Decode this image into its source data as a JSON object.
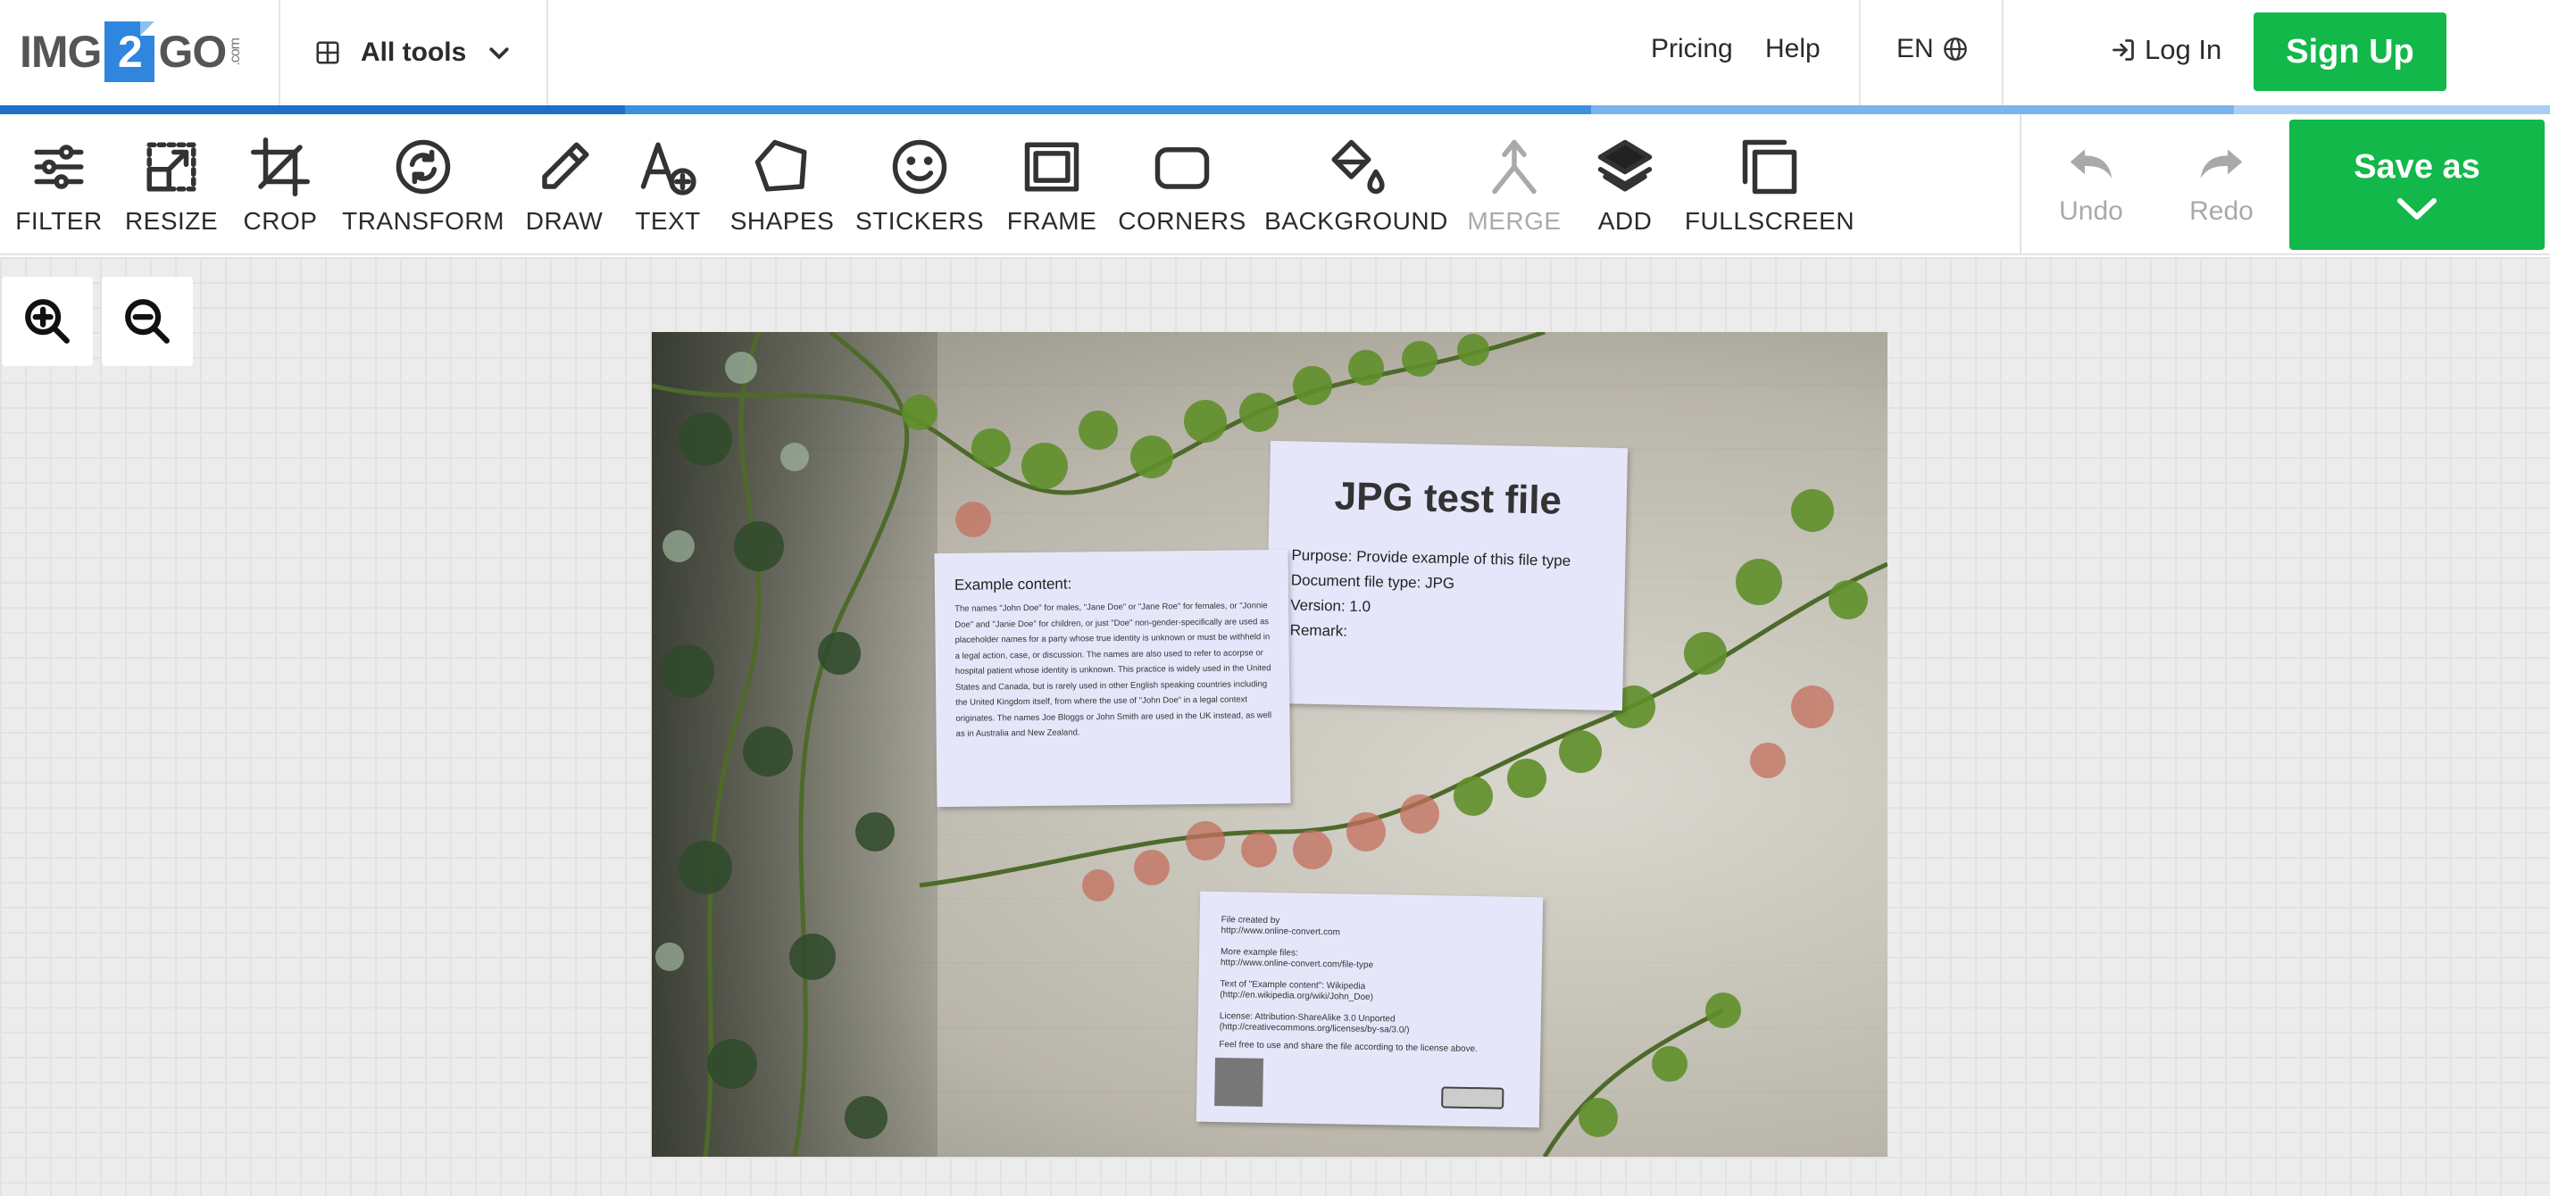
{
  "header": {
    "logo": {
      "img": "IMG",
      "two": "2",
      "go": "GO",
      "com": ".com"
    },
    "all_tools": "All tools",
    "pricing": "Pricing",
    "help": "Help",
    "language": "EN",
    "login": "Log In",
    "signup": "Sign Up"
  },
  "progress_colors": [
    "#1f6fc8",
    "#3d8fe0",
    "#7bb4ef",
    "#a9cff5"
  ],
  "toolbar": {
    "tools": [
      {
        "label": "FILTER",
        "icon": "sliders-icon",
        "enabled": true
      },
      {
        "label": "RESIZE",
        "icon": "resize-icon",
        "enabled": true
      },
      {
        "label": "CROP",
        "icon": "crop-icon",
        "enabled": true
      },
      {
        "label": "TRANSFORM",
        "icon": "rotate-icon",
        "enabled": true
      },
      {
        "label": "DRAW",
        "icon": "pencil-icon",
        "enabled": true
      },
      {
        "label": "TEXT",
        "icon": "text-add-icon",
        "enabled": true
      },
      {
        "label": "SHAPES",
        "icon": "pentagon-icon",
        "enabled": true
      },
      {
        "label": "STICKERS",
        "icon": "smiley-icon",
        "enabled": true
      },
      {
        "label": "FRAME",
        "icon": "frame-icon",
        "enabled": true
      },
      {
        "label": "CORNERS",
        "icon": "rounded-rect-icon",
        "enabled": true
      },
      {
        "label": "BACKGROUND",
        "icon": "paint-bucket-icon",
        "enabled": true
      },
      {
        "label": "MERGE",
        "icon": "merge-icon",
        "enabled": false
      },
      {
        "label": "ADD",
        "icon": "layers-icon",
        "enabled": true
      },
      {
        "label": "FULLSCREEN",
        "icon": "fullscreen-icon",
        "enabled": true
      }
    ],
    "undo": "Undo",
    "redo": "Redo",
    "save_as": "Save as"
  },
  "canvas": {
    "zoom_in": "zoom-in-icon",
    "zoom_out": "zoom-out-icon",
    "photo": {
      "paper_main": {
        "title": "JPG test file",
        "lines": [
          "Purpose: Provide example of this file type",
          "Document file type: JPG",
          "Version: 1.0",
          "Remark:"
        ]
      },
      "paper_left": {
        "heading": "Example content:",
        "body": "The names \"John Doe\" for males, \"Jane Doe\" or \"Jane Roe\" for females, or \"Jonnie Doe\" and \"Janie Doe\" for children, or just \"Doe\" non-gender-specifically are used as placeholder names for a party whose true identity is unknown or must be withheld in a legal action, case, or discussion. The names are also used to refer to acorpse or hospital patient whose identity is unknown. This practice is widely used in the United States and Canada, but is rarely used in other English speaking countries including the United Kingdom itself, from where the use of \"John Doe\" in a legal context originates. The names Joe Bloggs or John Smith are used in the UK instead, as well as in Australia and New Zealand."
      },
      "paper_bottom": {
        "lines": [
          "File created by",
          "http://www.online-convert.com",
          "",
          "More example files:",
          "http://www.online-convert.com/file-type",
          "",
          "Text of \"Example content\": Wikipedia",
          "(http://en.wikipedia.org/wiki/John_Doe)",
          "",
          "License: Attribution-ShareAlike 3.0 Unported",
          "(http://creativecommons.org/licenses/by-sa/3.0/)",
          "",
          "Feel free to use and share the file according to the license above."
        ]
      }
    }
  }
}
